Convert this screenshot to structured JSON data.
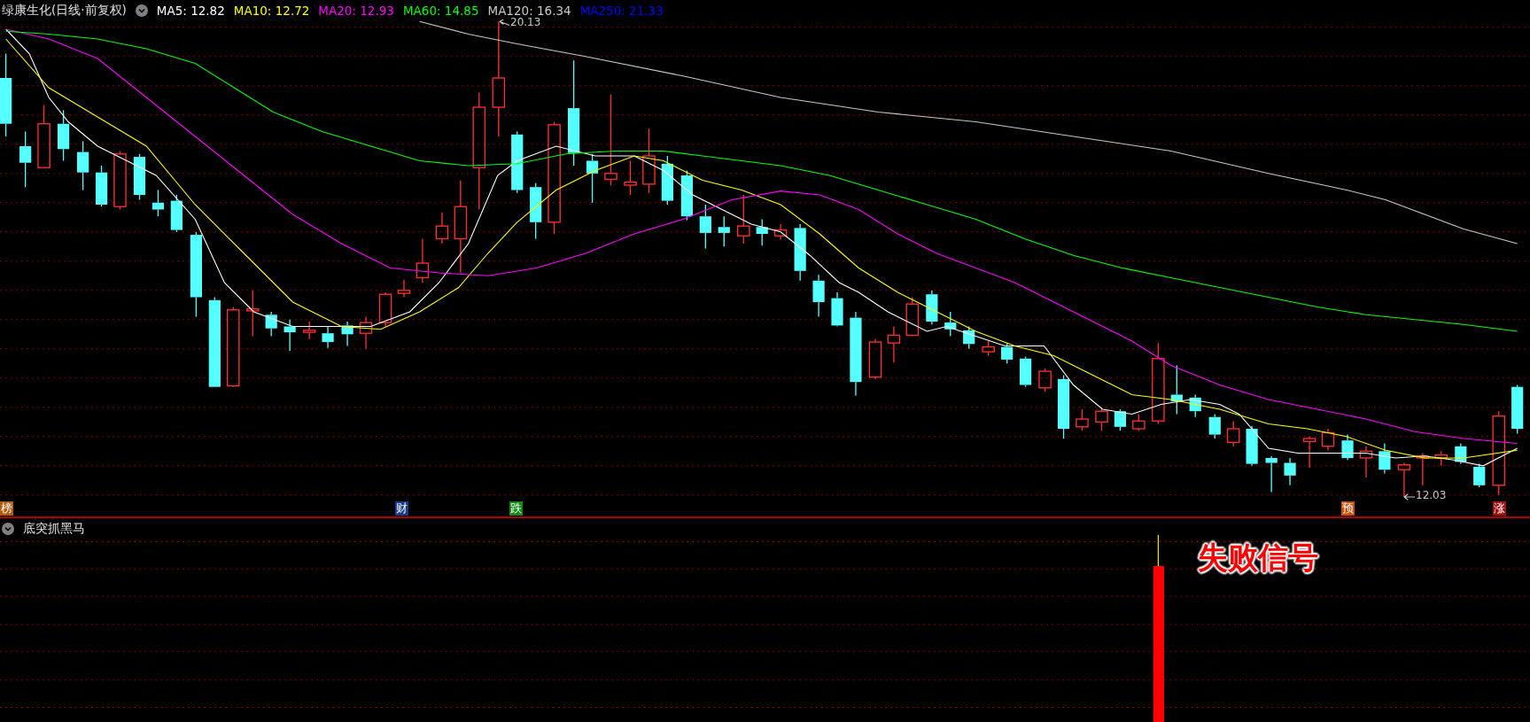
{
  "chart_title": "绿康生化(日线·前复权)",
  "ma_legend": [
    {
      "label": "MA5: 12.82",
      "color": "#ffffff"
    },
    {
      "label": "MA10: 12.72",
      "color": "#ffff00"
    },
    {
      "label": "MA20: 12.93",
      "color": "#ff00ff"
    },
    {
      "label": "MA60: 14.85",
      "color": "#00ff00"
    },
    {
      "label": "MA120: 16.34",
      "color": "#c8c8c8"
    },
    {
      "label": "MA250: 21.33",
      "color": "#0000ff"
    }
  ],
  "price_labels": [
    {
      "kind": "high",
      "text": "20.13"
    },
    {
      "kind": "low",
      "text": "12.03"
    }
  ],
  "event_markers": [
    {
      "text": "榜",
      "color": "#b05a10"
    },
    {
      "text": "财",
      "color": "#1a3a8a"
    },
    {
      "text": "跌",
      "color": "#108a10"
    },
    {
      "text": "预",
      "color": "#c8500a"
    },
    {
      "text": "涨",
      "color": "#a01010"
    }
  ],
  "indicator": {
    "name": "底突抓黑马",
    "annotation": "失败信号"
  }
}
